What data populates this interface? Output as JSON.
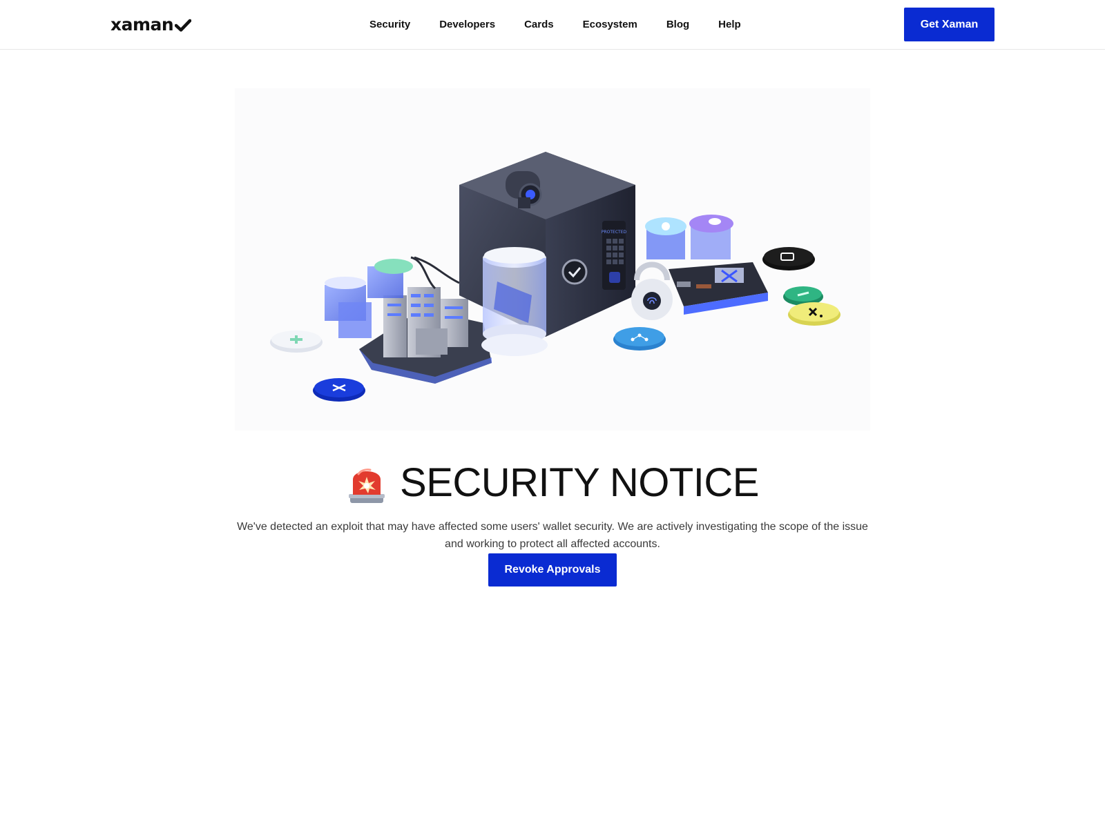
{
  "header": {
    "logo_text": "xaman",
    "logo_icon": "checkmark-icon",
    "nav": [
      {
        "label": "Security"
      },
      {
        "label": "Developers"
      },
      {
        "label": "Cards"
      },
      {
        "label": "Ecosystem"
      },
      {
        "label": "Blog"
      },
      {
        "label": "Help"
      }
    ],
    "cta_label": "Get Xaman"
  },
  "hero": {
    "icon": "security-illustration",
    "keypad_label": "PROTECTED"
  },
  "notice": {
    "icon": "police-siren-emoji",
    "title": "SECURITY NOTICE",
    "body": "We've detected an exploit that may have affected some users' wallet security. We are actively investigating the scope of the issue and working to protect all affected accounts.",
    "button_label": "Revoke Approvals"
  },
  "colors": {
    "accent": "#0a2bd2",
    "text": "#111111",
    "body_text": "#3a3a3a"
  }
}
